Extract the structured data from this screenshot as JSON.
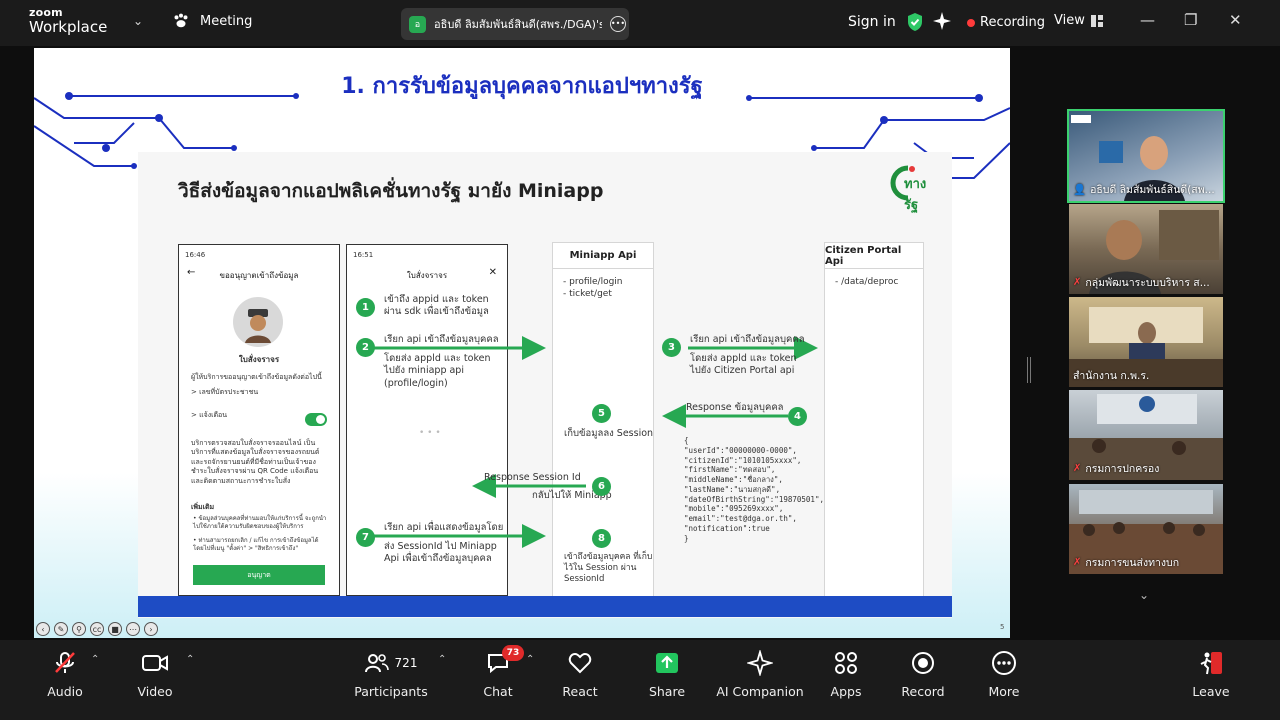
{
  "app": {
    "logo_line1": "zoom",
    "logo_line2": "Workplace",
    "meeting_label": "Meeting",
    "sharer_initial": "อ",
    "sharer_name": "อธิบดี ลิมสัมพันธ์สินดี(สพร./DGA)'s s",
    "signin": "Sign in",
    "recording": "Recording",
    "view": "View"
  },
  "slide": {
    "title": "1. การรับข้อมูลบุคคลจากแอปฯทางรัฐ",
    "card_title": "วิธีส่งข้อมูลจากแอปพลิเคชั่นทางรัฐ มายัง Miniapp",
    "brand": "ทางรัฐ",
    "page_number": "5",
    "phone1": {
      "time": "16:46",
      "header": "ขออนุญาตเข้าถึงข้อมูล",
      "name": "ใบสั่งจราจร",
      "desc": "ผู้ให้บริการขออนุญาตเข้าถึงข้อมูลดังต่อไปนี้",
      "id_item": "> เลขที่บัตรประชาชน",
      "notify": "> แจ้งเตือน",
      "body": "บริการตรวจสอบใบสั่งจราจรออนไลน์ เป็นบริการที่แสดงข้อมูลใบสั่งจราจรของรถยนต์และรถจักรยานยนต์ที่มีชื่อท่านเป็นเจ้าของ ชำระใบสั่งจราจรผ่าน QR Code แจ้งเตือนและติดตามสถานะการชำระใบสั่ง",
      "more": "เพิ่มเติม",
      "more1": "• ข้อมูลส่วนบุคคลที่ท่านมอบให้แก่บริการนี้ จะถูกนำไปใช้ภายใต้ความรับผิดชอบของผู้ให้บริการ",
      "more2": "• ท่านสามารถยกเลิก / แก้ไข การเข้าถึงข้อมูลได้ โดยไปที่เมนู \"ตั้งค่า\" > \"สิทธิการเข้าถึง\"",
      "button": "อนุญาต"
    },
    "phone2": {
      "time": "16:51",
      "header": "ใบสั่งจราจร",
      "loading": "• • •"
    },
    "miniapp": {
      "header": "Miniapp Api",
      "line1": "- profile/login",
      "line2": "- ticket/get"
    },
    "portal": {
      "header": "Citizen Portal Api",
      "line1": "- /data/deproc"
    },
    "steps": [
      {
        "num": "1",
        "text": "เข้าถึง appid และ token ผ่าน sdk เพื่อเข้าถึงข้อมูล"
      },
      {
        "num": "2",
        "text": "เรียก api เข้าถึงข้อมูลบุคคล",
        "sub": "โดยส่ง appld และ token ไปยัง miniapp api (profile/login)"
      },
      {
        "num": "3",
        "text": "เรียก api เข้าถึงข้อมูลบุคคล",
        "sub": "โดยส่ง appld และ token ไปยัง Citizen Portal api"
      },
      {
        "num": "4",
        "text": "Response ข้อมูลบุคคล"
      },
      {
        "num": "5",
        "text": "เก็บข้อมูลลง Session"
      },
      {
        "num": "6",
        "text": "Response Session Id",
        "sub": "กลับไปให้ Miniapp"
      },
      {
        "num": "7",
        "text": "เรียก api เพื่อแสดงข้อมูลโดย",
        "sub": "ส่ง SessionId ไป Miniapp Api เพื่อเข้าถึงข้อมูลบุคคล"
      },
      {
        "num": "8",
        "text": "เข้าถึงข้อมูลบุคคล ที่เก็บไว้ใน Session ผ่าน SessionId"
      }
    ],
    "json_lines": [
      "{",
      "  \"userId\":\"00000000-0000\",",
      "  \"citizenId\":\"1010105xxxx\",",
      "  \"firstName\":\"ทดสอบ\",",
      "  \"middleName\":\"ชื่อกลาง\",",
      "  \"lastName\":\"นามสกุลดี\",",
      "  \"dateOfBirthString\":\"19870501\",",
      "  \"mobile\":\"095269xxxx\",",
      "  \"email\":\"test@dga.or.th\",",
      "  \"notification\":true",
      "}"
    ]
  },
  "participants_tiles": [
    {
      "name": "อธิบดี ลิมสัมพันธ์สินดี(สพ...",
      "muted": false
    },
    {
      "name": "กลุ่มพัฒนาระบบบริหาร ส...",
      "muted": true
    },
    {
      "name": "สำนักงาน ก.พ.ร.",
      "muted": false
    },
    {
      "name": "กรมการปกครอง",
      "muted": true
    },
    {
      "name": "กรมการขนส่งทางบก",
      "muted": true
    }
  ],
  "toolbar": {
    "audio": "Audio",
    "video": "Video",
    "participants": "Participants",
    "participants_count": "721",
    "chat": "Chat",
    "chat_badge": "73",
    "react": "React",
    "share": "Share",
    "ai_companion": "AI Companion",
    "apps": "Apps",
    "record": "Record",
    "more": "More",
    "leave": "Leave"
  },
  "colors": {
    "accent_green": "#27a852",
    "slide_title_blue": "#1b2fbf",
    "recording_red": "#ff3b3b",
    "leave_red": "#e02a2a"
  }
}
